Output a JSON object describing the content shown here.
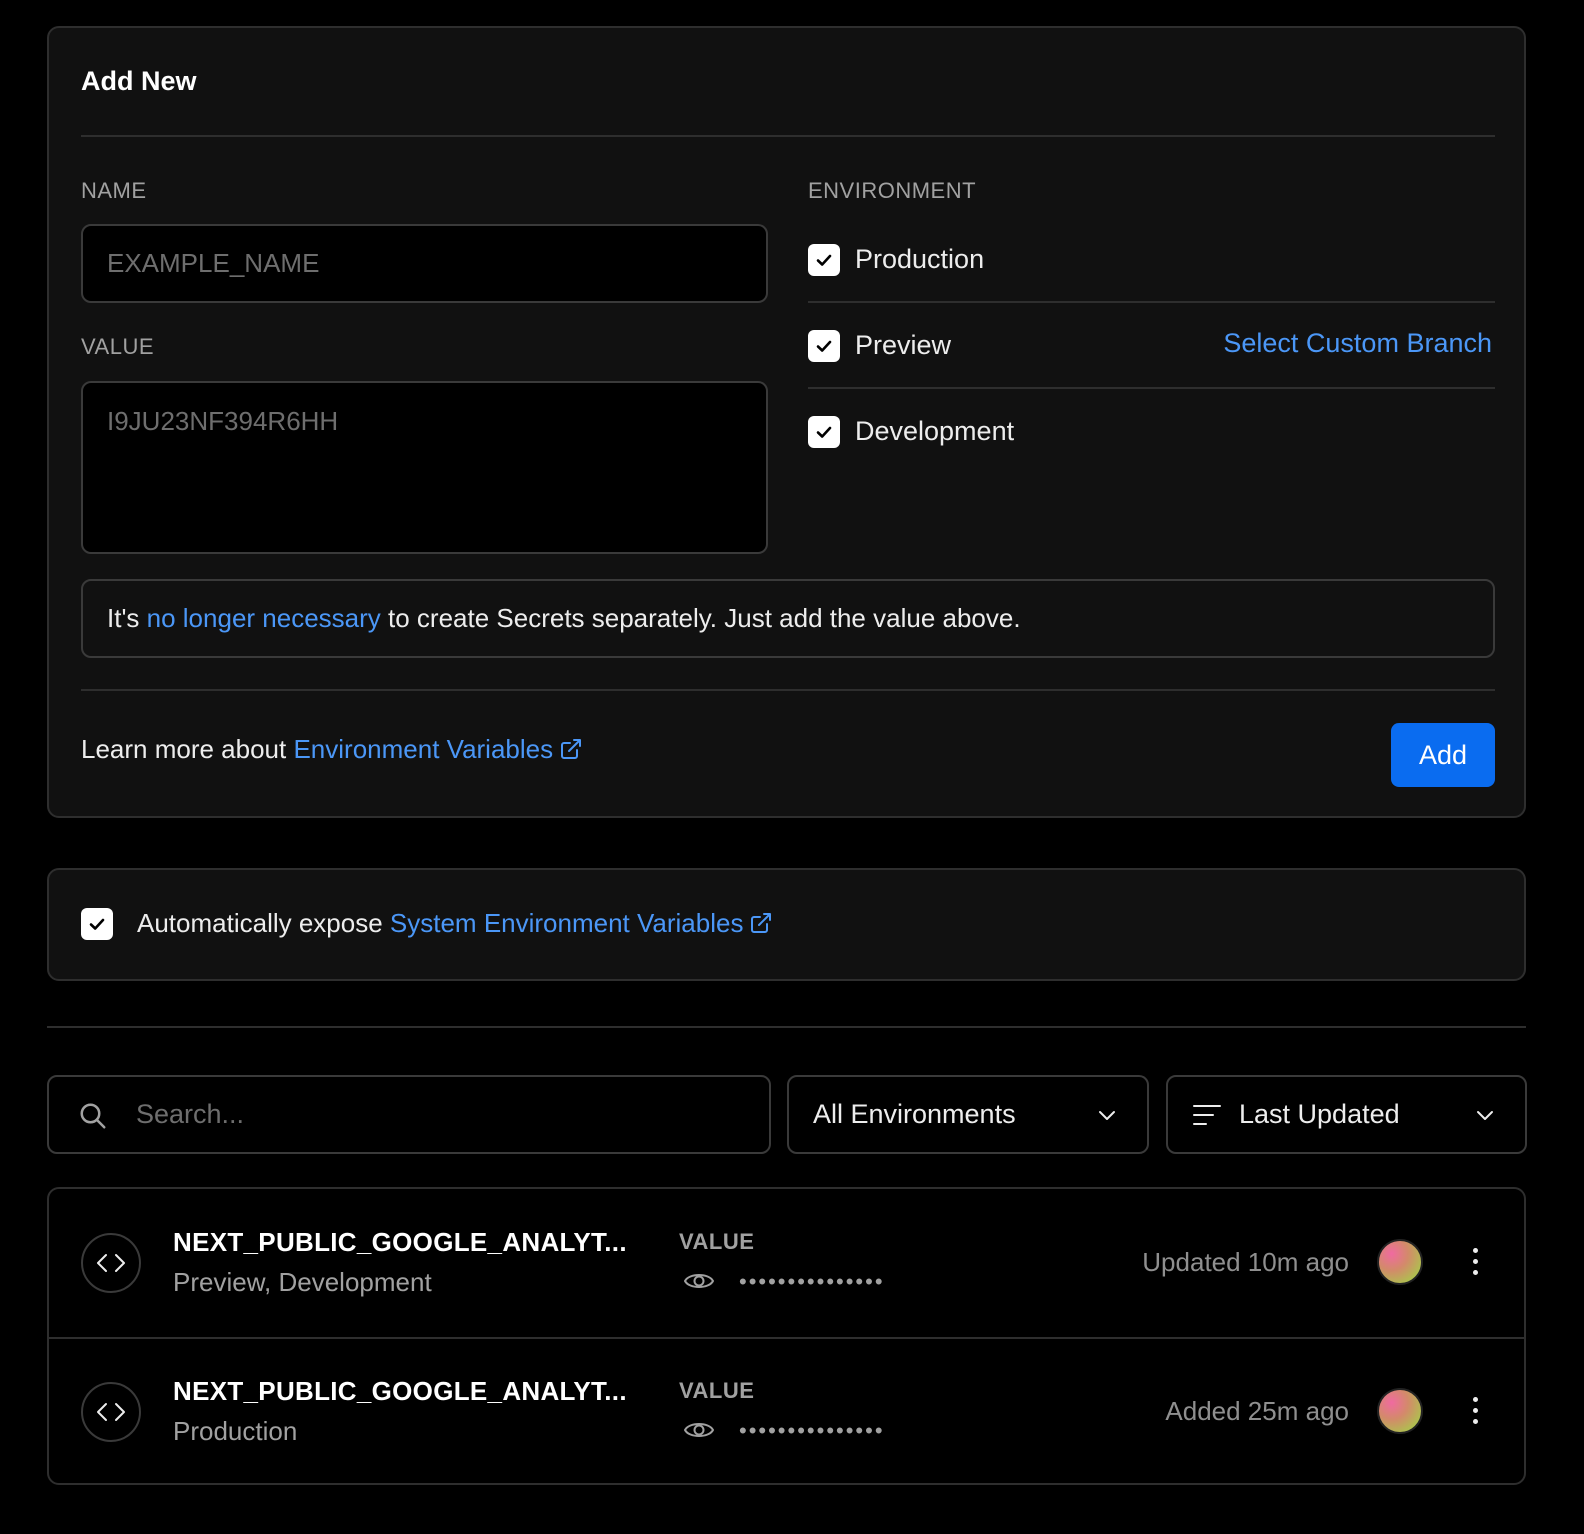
{
  "add_new": {
    "title": "Add New",
    "name_label": "NAME",
    "name_placeholder": "EXAMPLE_NAME",
    "value_label": "VALUE",
    "value_placeholder": "I9JU23NF394R6HH",
    "environment_label": "ENVIRONMENT",
    "environments": [
      {
        "label": "Production",
        "checked": true
      },
      {
        "label": "Preview",
        "checked": true
      },
      {
        "label": "Development",
        "checked": true
      }
    ],
    "custom_branch_link": "Select Custom Branch",
    "notice": {
      "prefix": "It's ",
      "link": "no longer necessary",
      "suffix": " to create Secrets separately. Just add the value above."
    },
    "learn_more": {
      "prefix": "Learn more about ",
      "link": "Environment Variables"
    },
    "add_button": "Add"
  },
  "auto_expose": {
    "checked": true,
    "prefix": "Automatically expose ",
    "link": "System Environment Variables"
  },
  "filters": {
    "search_placeholder": "Search...",
    "environment_select": "All Environments",
    "sort_select": "Last Updated"
  },
  "variables": [
    {
      "name": "NEXT_PUBLIC_GOOGLE_ANALYT...",
      "environments": "Preview, Development",
      "value_label": "VALUE",
      "masked_value": "•••••••••••••••",
      "status": "Updated 10m ago"
    },
    {
      "name": "NEXT_PUBLIC_GOOGLE_ANALYT...",
      "environments": "Production",
      "value_label": "VALUE",
      "masked_value": "•••••••••••••••",
      "status": "Added 25m ago"
    }
  ],
  "colors": {
    "accent": "#0a6cf0",
    "link": "#4b97f7",
    "card_bg": "#111111",
    "border": "#2e2e2e"
  }
}
